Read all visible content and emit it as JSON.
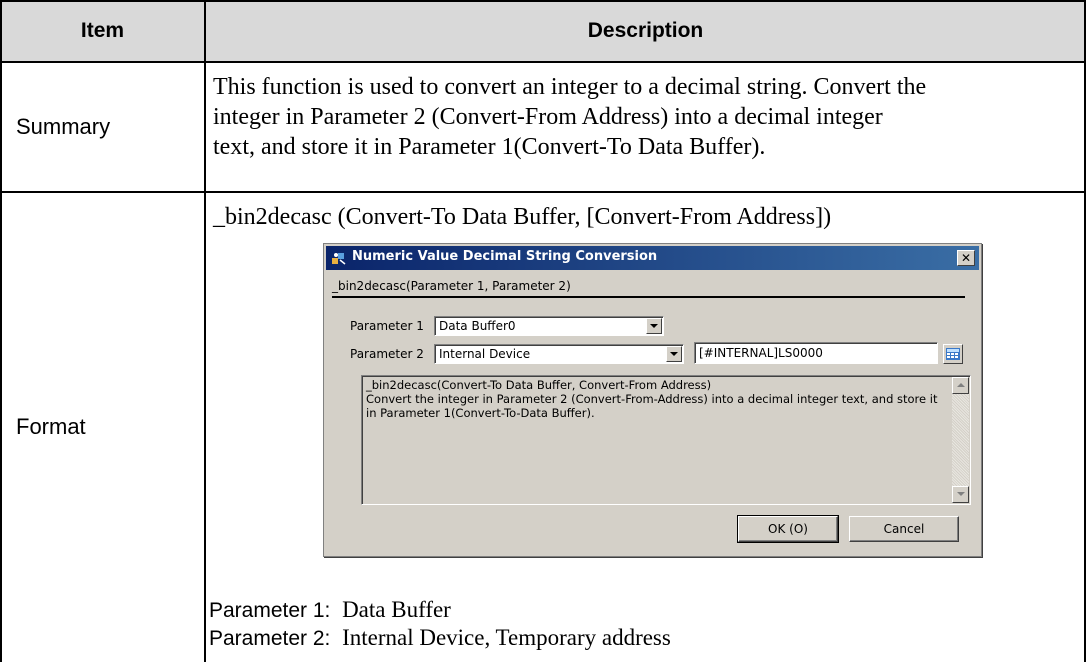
{
  "table": {
    "header": {
      "item": "Item",
      "description": "Description"
    },
    "summary": {
      "label": "Summary",
      "lines": [
        "This function is used to convert an integer to a decimal string. Convert the",
        "integer in Parameter 2 (Convert-From Address) into a decimal integer",
        "text, and store it in Parameter 1(Convert-To Data Buffer)."
      ]
    },
    "format": {
      "label": "Format",
      "syntax": "_bin2decasc (Convert-To Data Buffer, [Convert-From Address])",
      "param1_label": "Parameter 1:",
      "param1_value": "Data Buffer",
      "param2_label": "Parameter 2:",
      "param2_value": "Internal Device, Temporary address"
    }
  },
  "dialog": {
    "title": "Numeric Value Decimal String Conversion",
    "close_glyph": "✕",
    "syntax": "_bin2decasc(Parameter 1, Parameter 2)",
    "param1_label": "Parameter 1",
    "param1_value": "Data Buffer0",
    "param2_label": "Parameter 2",
    "param2_value": "Internal Device",
    "address_value": "[#INTERNAL]LS0000",
    "description": "_bin2decasc(Convert-To Data Buffer, Convert-From Address)\nConvert the integer in Parameter 2 (Convert-From-Address) into a decimal integer text, and store it\nin Parameter 1(Convert-To-Data Buffer).",
    "ok_label": "OK (O)",
    "cancel_label": "Cancel",
    "icons": [
      "app-icon",
      "close-icon",
      "dropdown-arrow-icon",
      "keypad-icon",
      "scroll-up-arrow-icon",
      "scroll-down-arrow-icon"
    ]
  }
}
